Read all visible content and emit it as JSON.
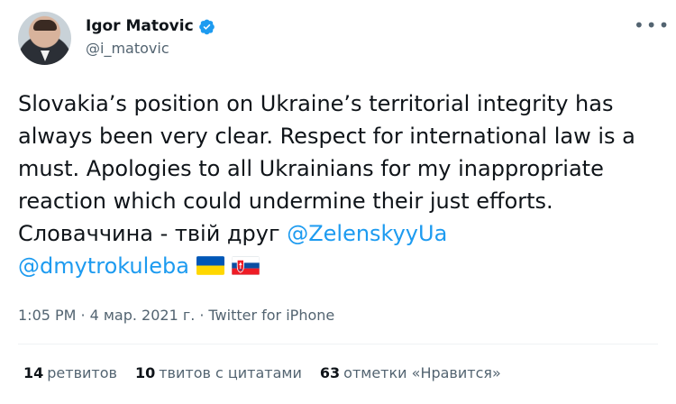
{
  "author": {
    "display_name": "Igor Matovic",
    "handle": "@i_matovic",
    "verified": true
  },
  "more_icon": "more-horizontal-icon",
  "tweet": {
    "line1": "Slovakia’s position on Ukraine’s territorial integrity has",
    "line2": "always been very clear. Respect for international law is a",
    "line3": "must. Apologies to all Ukrainians for my inappropriate",
    "line4": "reaction which could undermine their just efforts.",
    "line5_text": "Словаччина - твій друг ",
    "mention1": "@ZelenskyyUa",
    "mention2": "@dmytrokuleba",
    "flags": [
      "ukraine-flag-icon",
      "slovakia-flag-icon"
    ]
  },
  "meta": {
    "time": "1:05 PM",
    "sep1": "·",
    "date": "4 мар. 2021 г.",
    "sep2": "·",
    "source": "Twitter for iPhone"
  },
  "stats": {
    "retweets_count": "14",
    "retweets_label": "ретвитов",
    "quotes_count": "10",
    "quotes_label": "твитов с цитатами",
    "likes_count": "63",
    "likes_label": "отметки «Нравится»"
  },
  "colors": {
    "link": "#1d9bf0",
    "secondary": "#536471",
    "text": "#0f1419"
  }
}
